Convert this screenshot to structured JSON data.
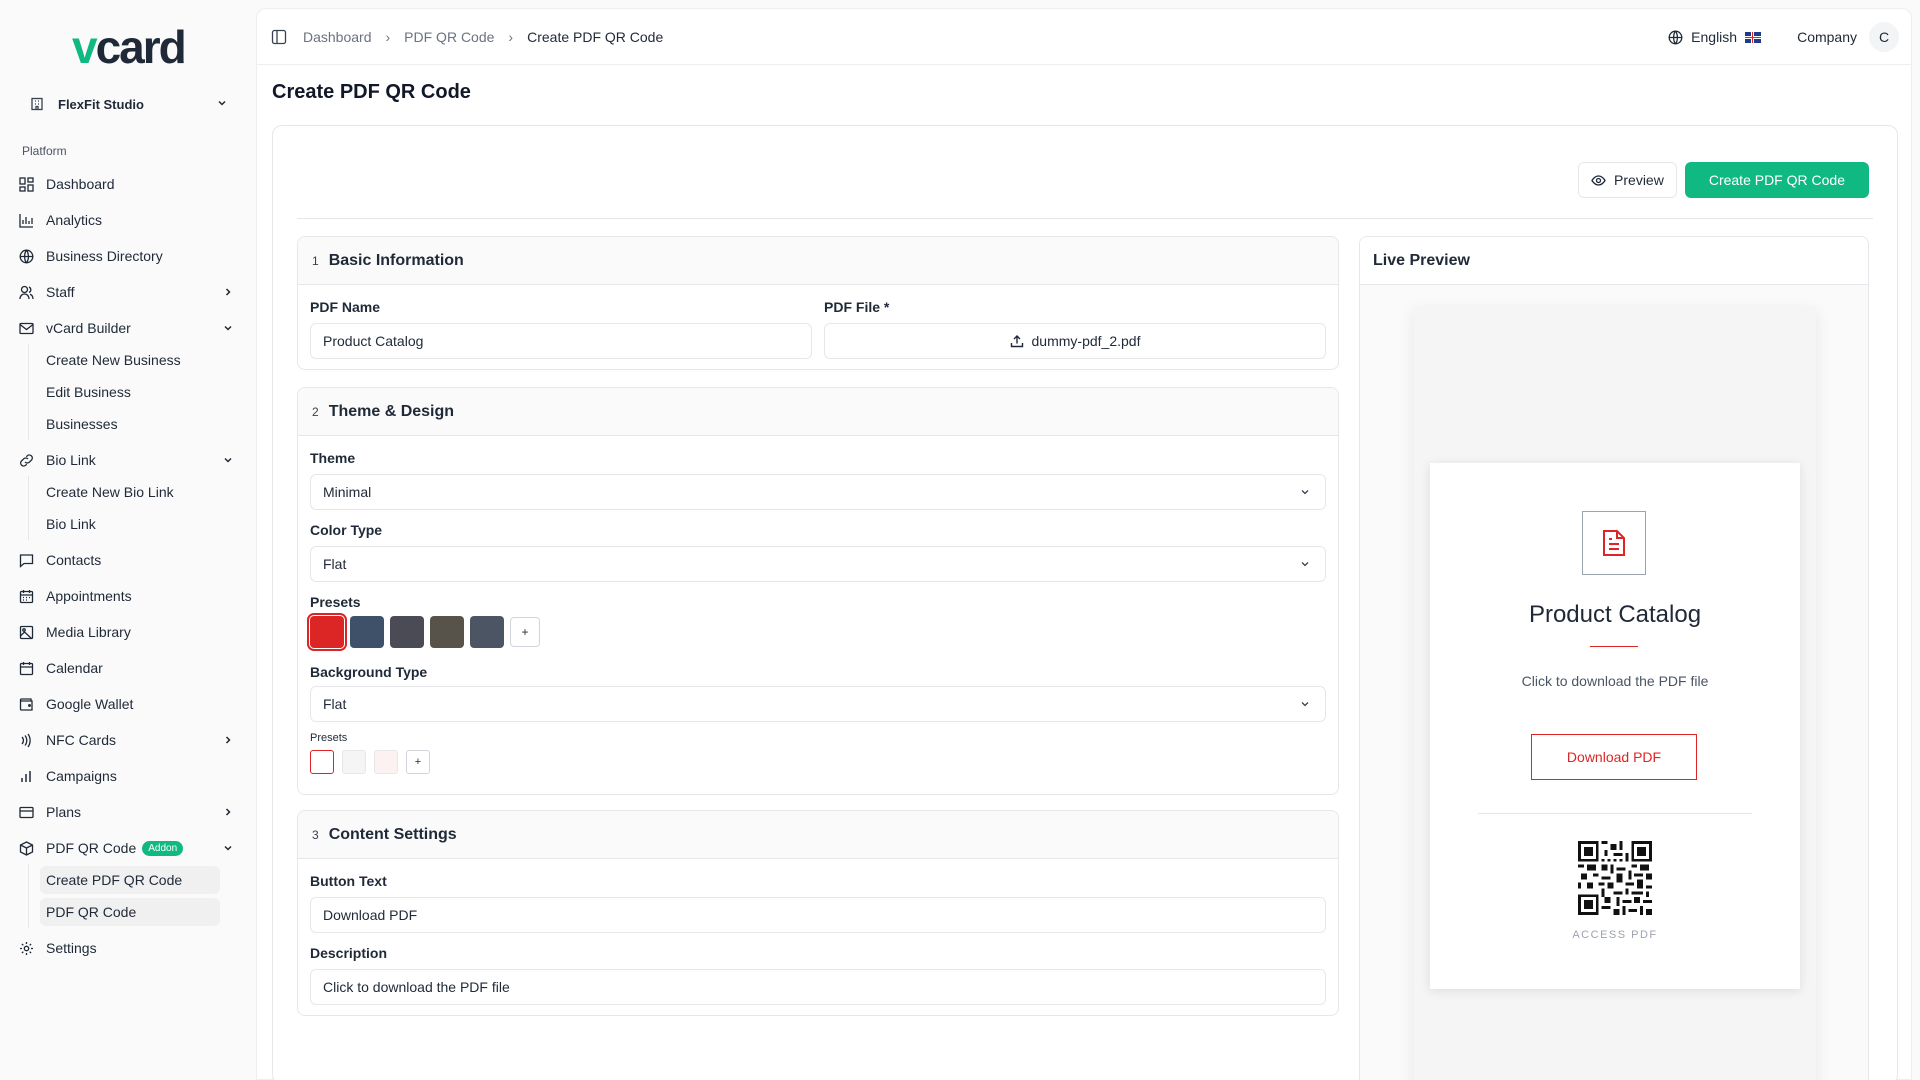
{
  "brand": {
    "logo_v": "v",
    "logo_rest": "card",
    "accent": "#10b981"
  },
  "workspace": {
    "name": "FlexFit Studio"
  },
  "sidebar": {
    "section_label": "Platform",
    "items": [
      {
        "label": "Dashboard",
        "icon": "dashboard-icon"
      },
      {
        "label": "Analytics",
        "icon": "analytics-icon"
      },
      {
        "label": "Business Directory",
        "icon": "globe-icon"
      },
      {
        "label": "Staff",
        "icon": "users-icon"
      },
      {
        "label": "vCard Builder",
        "icon": "mail-icon"
      },
      {
        "label": "Bio Link",
        "icon": "link-icon"
      },
      {
        "label": "Contacts",
        "icon": "message-icon"
      },
      {
        "label": "Appointments",
        "icon": "calendar-icon"
      },
      {
        "label": "Media Library",
        "icon": "image-icon"
      },
      {
        "label": "Calendar",
        "icon": "calendar-icon"
      },
      {
        "label": "Google Wallet",
        "icon": "wallet-icon"
      },
      {
        "label": "NFC Cards",
        "icon": "nfc-icon"
      },
      {
        "label": "Campaigns",
        "icon": "bar-chart-icon"
      },
      {
        "label": "Plans",
        "icon": "card-icon"
      },
      {
        "label": "PDF QR Code",
        "icon": "box-icon",
        "badge": "Addon"
      },
      {
        "label": "Settings",
        "icon": "gear-icon"
      }
    ],
    "vcard_sub": [
      "Create New Business",
      "Edit Business",
      "Businesses"
    ],
    "bio_sub": [
      "Create New Bio Link",
      "Bio Link"
    ],
    "pdf_sub": [
      "Create PDF QR Code",
      "PDF QR Code"
    ]
  },
  "topbar": {
    "breadcrumbs": [
      "Dashboard",
      "PDF QR Code",
      "Create PDF QR Code"
    ],
    "language": "English",
    "company": "Company",
    "avatar_initial": "C"
  },
  "page": {
    "title": "Create PDF QR Code"
  },
  "actions": {
    "preview_label": "Preview",
    "create_label": "Create PDF QR Code"
  },
  "sections": {
    "basic": {
      "number": "1",
      "title": "Basic Information",
      "pdf_name_label": "PDF Name",
      "pdf_name_value": "Product Catalog",
      "pdf_file_label": "PDF File *",
      "pdf_file_value": "dummy-pdf_2.pdf"
    },
    "theme": {
      "number": "2",
      "title": "Theme & Design",
      "theme_label": "Theme",
      "theme_value": "Minimal",
      "color_type_label": "Color Type",
      "color_type_value": "Flat",
      "presets_label": "Presets",
      "color_presets": [
        "#dc2626",
        "#3f5069",
        "#4b4b55",
        "#57534a",
        "#4b5563"
      ],
      "add_label": "+",
      "bg_type_label": "Background Type",
      "bg_type_value": "Flat",
      "bg_presets_label": "Presets",
      "bg_presets": [
        "#ffffff",
        "#f5f5f5",
        "#fdf2f2"
      ]
    },
    "content": {
      "number": "3",
      "title": "Content Settings",
      "button_text_label": "Button Text",
      "button_text_value": "Download PDF",
      "description_label": "Description",
      "description_value": "Click to download the PDF file"
    }
  },
  "live_preview": {
    "header": "Live Preview",
    "title": "Product Catalog",
    "description": "Click to download the PDF file",
    "button": "Download PDF",
    "access_label": "ACCESS PDF",
    "accent": "#dc2626"
  }
}
